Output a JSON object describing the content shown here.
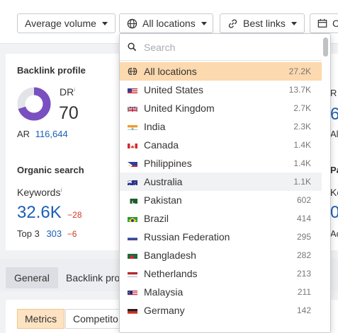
{
  "filters": {
    "volume_label": "Average volume",
    "locations_label": "All locations",
    "links_label": "Best links",
    "partial_label": "C"
  },
  "backlink_profile": {
    "title": "Backlink profile",
    "dr_label": "DR",
    "dr_info": "i",
    "dr_value": "70",
    "dr_fraction": 0.7,
    "ar_label": "AR",
    "ar_value": "116,644"
  },
  "organic_search": {
    "title": "Organic search",
    "keywords_label": "Keywords",
    "keywords_info": "i",
    "keywords_value": "32.6K",
    "keywords_change": "−28",
    "top3_label": "Top 3",
    "top3_value": "303",
    "top3_change": "−6"
  },
  "right_partial": {
    "r1": "R",
    "r2": "6",
    "r3": "Al",
    "r4": "Pa",
    "r5": "Ke",
    "r6": "0",
    "r7": "Ac"
  },
  "tabs": [
    "General",
    "Backlink pro"
  ],
  "segments": [
    "Metrics",
    "Competito"
  ],
  "dropdown": {
    "search_placeholder": "Search",
    "items": [
      {
        "label": "All locations",
        "count": "27.2K",
        "flag": "globe"
      },
      {
        "label": "United States",
        "count": "13.7K",
        "flag": "us"
      },
      {
        "label": "United Kingdom",
        "count": "2.7K",
        "flag": "uk"
      },
      {
        "label": "India",
        "count": "2.3K",
        "flag": "in"
      },
      {
        "label": "Canada",
        "count": "1.4K",
        "flag": "ca"
      },
      {
        "label": "Philippines",
        "count": "1.4K",
        "flag": "ph"
      },
      {
        "label": "Australia",
        "count": "1.1K",
        "flag": "au"
      },
      {
        "label": "Pakistan",
        "count": "602",
        "flag": "pk"
      },
      {
        "label": "Brazil",
        "count": "414",
        "flag": "br"
      },
      {
        "label": "Russian Federation",
        "count": "295",
        "flag": "ru"
      },
      {
        "label": "Bangladesh",
        "count": "282",
        "flag": "bd"
      },
      {
        "label": "Netherlands",
        "count": "213",
        "flag": "nl"
      },
      {
        "label": "Malaysia",
        "count": "211",
        "flag": "my"
      },
      {
        "label": "Germany",
        "count": "142",
        "flag": "de"
      }
    ]
  },
  "colors": {
    "accent_orange": "#fcd9ae",
    "link_blue": "#1a5fb4",
    "negative_red": "#d03a2b",
    "donut_purple": "#7a4fc0"
  }
}
